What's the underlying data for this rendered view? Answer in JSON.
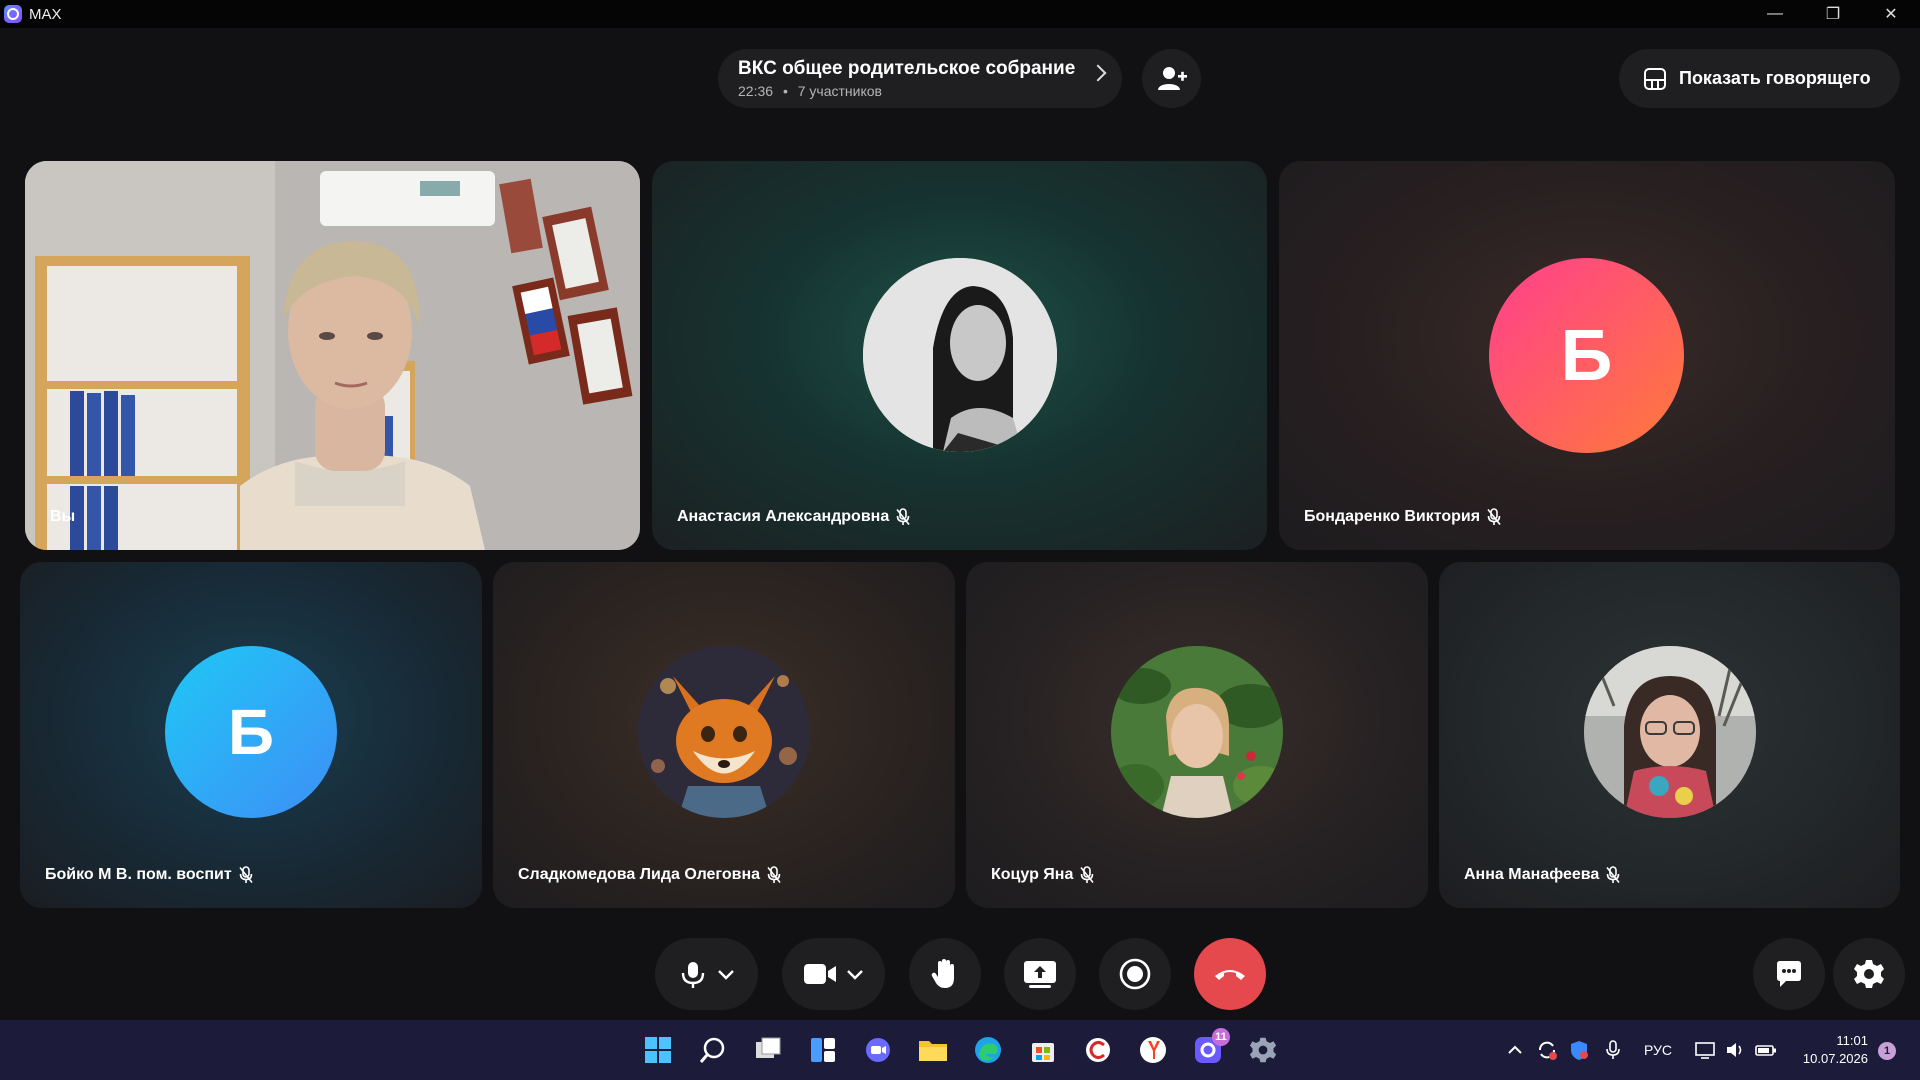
{
  "window": {
    "app_name": "MAX",
    "controls": [
      "—",
      "❐",
      "✕"
    ]
  },
  "call": {
    "title": "ВКС общее родительское собрание",
    "duration": "22:36",
    "separator": "•",
    "participants_count": "7 участников",
    "show_speaker_label": "Показать говорящего"
  },
  "tiles": [
    {
      "name": "Вы",
      "type": "video",
      "muted": false
    },
    {
      "name": "Анастасия Александровна",
      "type": "photo",
      "muted": true
    },
    {
      "name": "Бондаренко Виктория",
      "type": "letter",
      "letter": "Б",
      "muted": true
    },
    {
      "name": "Бойко М В. пом. воспит",
      "type": "letter",
      "letter": "Б",
      "muted": true
    },
    {
      "name": "Сладкомедова Лида Олеговна",
      "type": "photo",
      "muted": true
    },
    {
      "name": "Коцур Яна",
      "type": "photo",
      "muted": true
    },
    {
      "name": "Анна Манафеева",
      "type": "photo",
      "muted": true
    }
  ],
  "colors": {
    "end_call": "#e5484d",
    "avatar_b1_gradient": [
      "#ff3f8e",
      "#ff7a3a"
    ],
    "avatar_b2_gradient": [
      "#1fc8f5",
      "#3e8ef7"
    ]
  },
  "controls": [
    "microphone-icon",
    "video-camera-icon",
    "raise-hand-icon",
    "screen-share-icon",
    "record-icon",
    "end-call-icon",
    "chat-icon",
    "settings-icon"
  ],
  "taskbar": {
    "chat_badge": "11",
    "language": "РУС",
    "time": "11:01",
    "date": "10.07.2026",
    "notifications": "1"
  }
}
